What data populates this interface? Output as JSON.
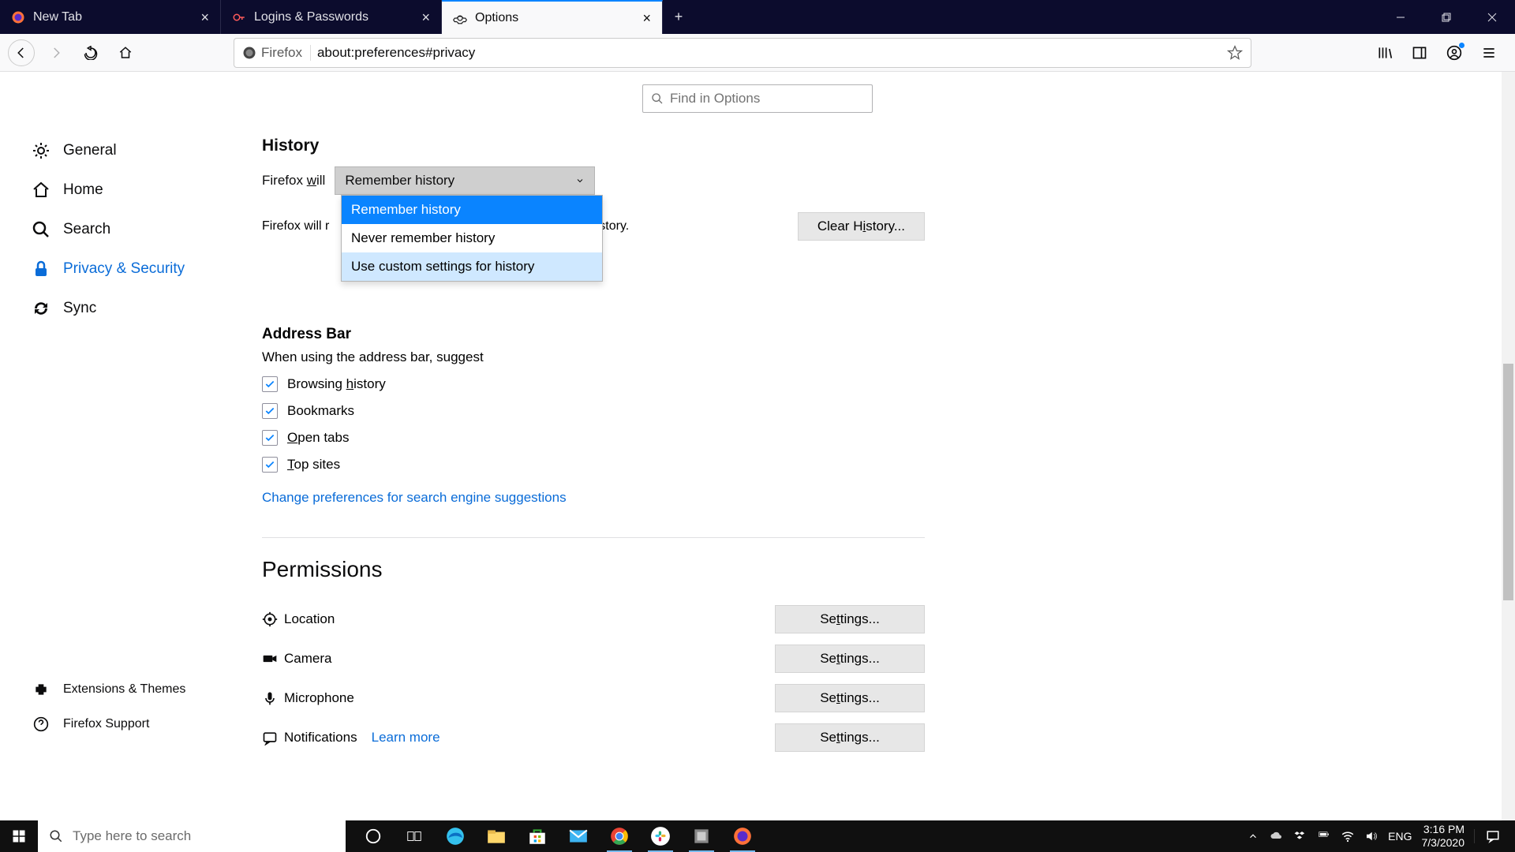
{
  "window": {
    "tabs": [
      {
        "label": "New Tab"
      },
      {
        "label": "Logins & Passwords"
      },
      {
        "label": "Options"
      }
    ],
    "active_tab_index": 2
  },
  "urlbar": {
    "identity_label": "Firefox",
    "url": "about:preferences#privacy"
  },
  "sidebar": {
    "items": [
      {
        "label": "General"
      },
      {
        "label": "Home"
      },
      {
        "label": "Search"
      },
      {
        "label": "Privacy & Security"
      },
      {
        "label": "Sync"
      }
    ],
    "bottom": [
      {
        "label": "Extensions & Themes"
      },
      {
        "label": "Firefox Support"
      }
    ],
    "active_index": 3
  },
  "search": {
    "placeholder": "Find in Options"
  },
  "history": {
    "section_title": "History",
    "prefix_label": "Firefox will",
    "prefix_underline": "w",
    "selected": "Remember history",
    "options": [
      "Remember history",
      "Never remember history",
      "Use custom settings for history"
    ],
    "desc_fragment": "m, and search history.",
    "desc_prefix": "Firefox will r",
    "clear_label": "Clear History...",
    "clear_underline_char": "i"
  },
  "addressbar": {
    "title": "Address Bar",
    "desc": "When using the address bar, suggest",
    "checks": [
      {
        "label": "Browsing history",
        "checked": true,
        "u": "h"
      },
      {
        "label": "Bookmarks",
        "checked": true,
        "u": ""
      },
      {
        "label": "Open tabs",
        "checked": true,
        "u": "O"
      },
      {
        "label": "Top sites",
        "checked": true,
        "u": "T"
      }
    ],
    "link": "Change preferences for search engine suggestions"
  },
  "permissions": {
    "title": "Permissions",
    "rows": [
      {
        "label": "Location",
        "settings": "Settings...",
        "u": "t"
      },
      {
        "label": "Camera",
        "settings": "Settings...",
        "u": "t"
      },
      {
        "label": "Microphone",
        "settings": "Settings...",
        "u": "t"
      },
      {
        "label": "Notifications",
        "settings": "Settings...",
        "u": "t",
        "learn_more": "Learn more"
      }
    ]
  },
  "taskbar": {
    "search_placeholder": "Type here to search",
    "lang": "ENG",
    "time": "3:16 PM",
    "date": "7/3/2020"
  }
}
